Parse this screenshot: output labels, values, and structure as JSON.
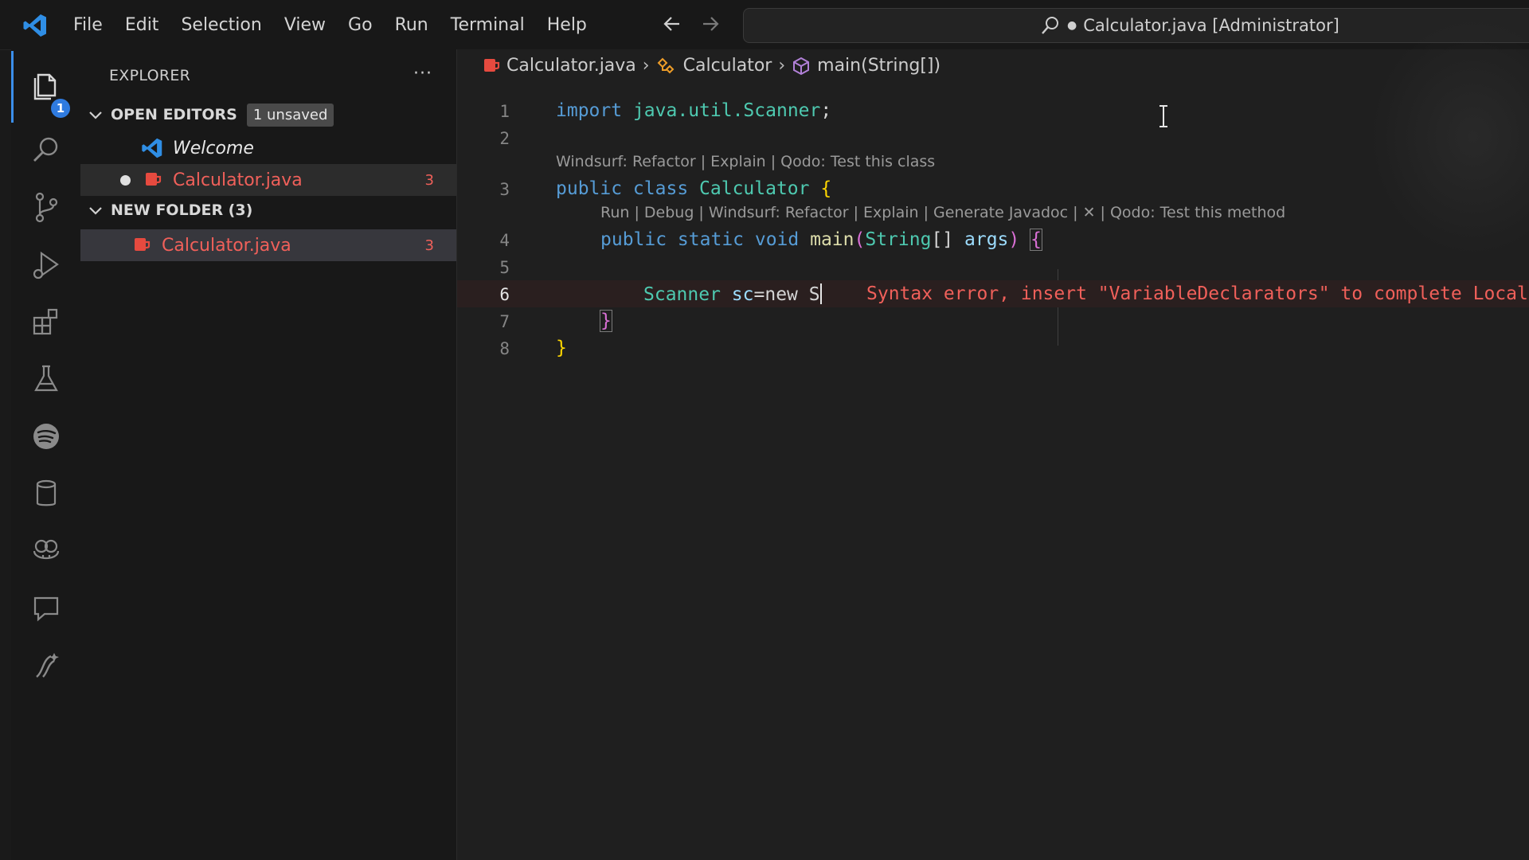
{
  "titlebar": {
    "menu": [
      "File",
      "Edit",
      "Selection",
      "View",
      "Go",
      "Run",
      "Terminal",
      "Help"
    ],
    "command_center": "Calculator.java [Administrator]",
    "dirty_marker": "●"
  },
  "activitybar": {
    "items": [
      "explorer-icon",
      "search-icon",
      "source-control-icon",
      "run-debug-icon",
      "extensions-icon",
      "testing-icon",
      "spotify-icon",
      "database-icon",
      "copilot-icon",
      "chat-icon",
      "windsurf-icon"
    ],
    "explorer_badge": "1"
  },
  "sidebar": {
    "header": "EXPLORER",
    "more": "···",
    "open_editors": {
      "title": "OPEN EDITORS",
      "badge": "1 unsaved",
      "items": [
        {
          "label": "Welcome"
        },
        {
          "label": "Calculator.java",
          "count": "3"
        }
      ]
    },
    "folder": {
      "title": "NEW FOLDER (3)",
      "items": [
        {
          "label": "Calculator.java",
          "count": "3"
        }
      ]
    }
  },
  "editor": {
    "breadcrumbs": [
      "Calculator.java",
      "Calculator",
      "main(String[])"
    ],
    "line_numbers": [
      "1",
      "2",
      "3",
      "4",
      "5",
      "6",
      "7",
      "8"
    ],
    "code": {
      "l1_kw": "import",
      "l1_pkg": "java.util.Scanner",
      "l1_semi": ";",
      "lens1": "Windsurf: Refactor | Explain | Qodo: Test this class",
      "l3_kw": "public class",
      "l3_name": "Calculator",
      "l3_brace": "{",
      "lens2": "Run | Debug | Windsurf: Refactor | Explain | Generate Javadoc | ✕ | Qodo: Test this method",
      "l4_kw": "public static void",
      "l4_fn": "main",
      "l4_paren_open": "(",
      "l4_type": "String",
      "l4_arr": "[]",
      "l4_param": "args",
      "l4_paren_close": ")",
      "l4_brace": "{",
      "l6_type": "Scanner",
      "l6_var": "sc",
      "l6_rest": "=new S",
      "l6_error": "Syntax error, insert \"VariableDeclarators\" to complete Local",
      "l7_brace": "}",
      "l8_brace": "}"
    }
  },
  "colors": {
    "accent": "#3b8eea",
    "error": "#f0605a",
    "keyword": "#569cd6",
    "type": "#4ec9b0",
    "function": "#dcdcaa",
    "param": "#9cdcfe"
  }
}
